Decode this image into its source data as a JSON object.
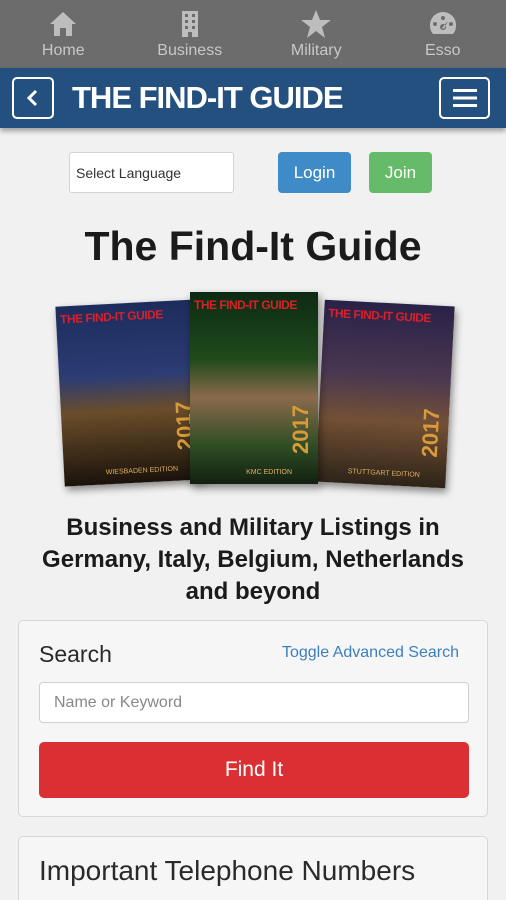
{
  "tabs": [
    {
      "label": "Home",
      "icon": "home-icon"
    },
    {
      "label": "Business",
      "icon": "building-icon"
    },
    {
      "label": "Military",
      "icon": "star-icon"
    },
    {
      "label": "Esso",
      "icon": "gauge-icon"
    }
  ],
  "header": {
    "logo_text": "THE FIND-IT GUIDE",
    "back_icon": "chevron-left-icon",
    "menu_icon": "hamburger-menu-icon",
    "bar_color": "#23507f"
  },
  "language": {
    "label": "Select Language"
  },
  "auth": {
    "login": "Login",
    "join": "Join"
  },
  "page_title": "The Find-It Guide",
  "covers": [
    {
      "title": "THE FIND-IT GUIDE",
      "year": "2017",
      "edition": "WIESBADEN EDITION"
    },
    {
      "title": "THE FIND-IT GUIDE",
      "year": "2017",
      "edition": "KMC EDITION"
    },
    {
      "title": "THE FIND-IT GUIDE",
      "year": "2017",
      "edition": "STUTTGART EDITION"
    }
  ],
  "tagline": "Business and Military Listings in Germany, Italy, Belgium, Netherlands and beyond",
  "search": {
    "label": "Search",
    "toggle": "Toggle Advanced Search",
    "placeholder": "Name or Keyword",
    "button": "Find It"
  },
  "important": {
    "title": "Important Telephone Numbers"
  },
  "colors": {
    "login": "#3f8bc8",
    "join": "#66bb6a",
    "find": "#db3033",
    "link": "#3c7fbf"
  }
}
